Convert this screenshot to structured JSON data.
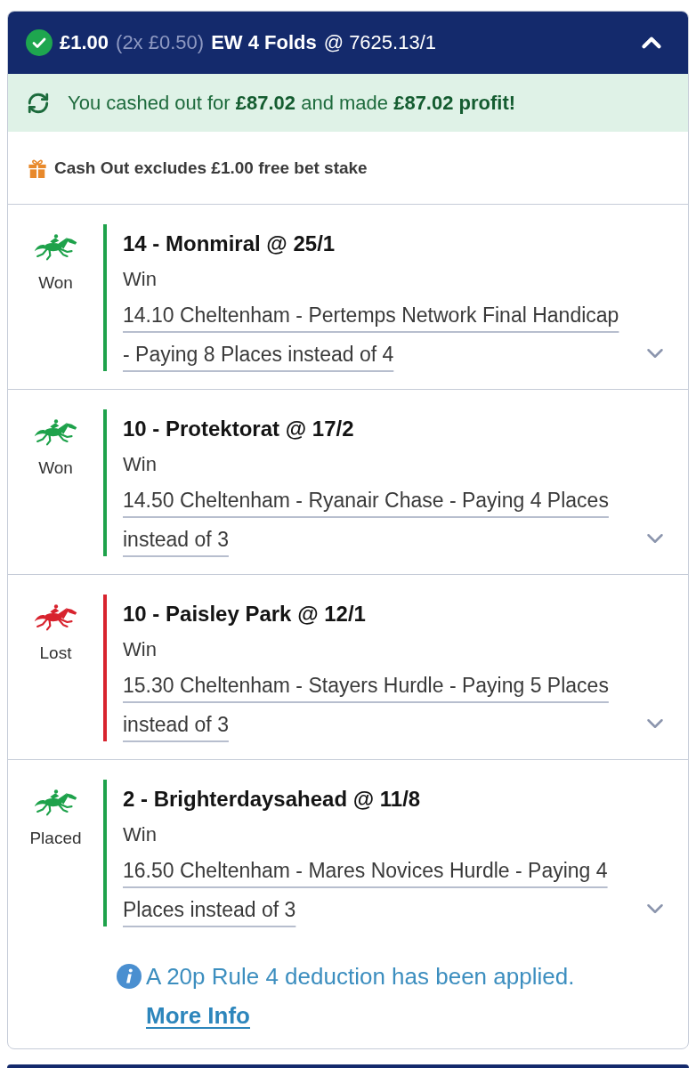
{
  "header": {
    "stake": "£1.00",
    "split": "(2x £0.50)",
    "bet_type": "EW 4 Folds",
    "odds": "@ 7625.13/1",
    "expanded": true
  },
  "cashout": {
    "message": "You cashed out for **£87.02** and made **£87.02 profit!**"
  },
  "free_bet_note": "Cash Out excludes £1.00 free bet stake",
  "selections": [
    {
      "result": "Won",
      "color": "#1ea24b",
      "title": "14 - Monmiral @ 25/1",
      "market": "Win",
      "event": "14.10 Cheltenham - Pertemps Network Final Handicap - Paying 8 Places instead of 4",
      "expanded": false
    },
    {
      "result": "Won",
      "color": "#1ea24b",
      "title": "10 - Protektorat @ 17/2",
      "market": "Win",
      "event": "14.50 Cheltenham - Ryanair Chase - Paying 4 Places instead of 3",
      "expanded": false
    },
    {
      "result": "Lost",
      "color": "#d8232e",
      "title": "10 - Paisley Park @ 12/1",
      "market": "Win",
      "event": "15.30 Cheltenham - Stayers Hurdle - Paying 5 Places instead of 3",
      "expanded": false
    },
    {
      "result": "Placed",
      "color": "#1ea24b",
      "title": "2 - Brighterdaysahead @ 11/8",
      "market": "Win",
      "event": "16.50 Cheltenham - Mares Novices Hurdle - Paying 4 Places instead of 3",
      "expanded": false
    }
  ],
  "rule4_notice": {
    "text": "A 20p Rule 4 deduction has been applied.",
    "link": "More Info"
  }
}
